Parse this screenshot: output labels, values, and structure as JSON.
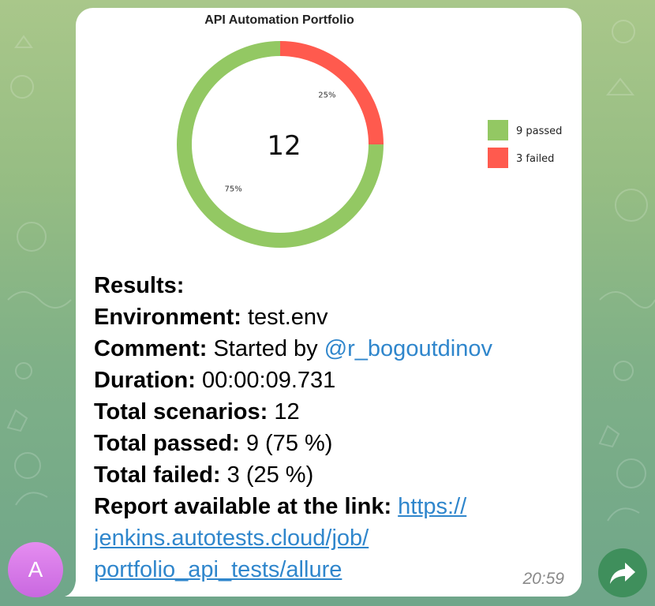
{
  "chart_data": {
    "type": "pie",
    "title": "API Automation Portfolio",
    "center_label": "12",
    "categories": [
      "passed",
      "failed"
    ],
    "values": [
      9,
      3
    ],
    "percent_labels": [
      "75%",
      "25%"
    ],
    "legend": [
      "9 passed",
      "3 failed"
    ],
    "legend_position": "right",
    "colors": [
      "#93c863",
      "#ff5a4e"
    ],
    "donut": true
  },
  "message": {
    "results_heading": "Results:",
    "environment_key": "Environment:",
    "environment_value": "test.env",
    "comment_key": "Comment:",
    "comment_value": "Started by",
    "comment_mention": "@r_bogoutdinov",
    "duration_key": "Duration:",
    "duration_value": "00:00:09.731",
    "scenarios_key": "Total scenarios:",
    "scenarios_value": "12",
    "passed_key": "Total passed:",
    "passed_value": "9 (75 %)",
    "failed_key": "Total failed:",
    "failed_value": "3 (25 %)",
    "report_key": "Report available at the link:",
    "report_link_part1": "https://",
    "report_link_part2": "jenkins.autotests.cloud/job/",
    "report_link_part3": "portfolio_api_tests/allure",
    "time": "20:59"
  },
  "avatar": {
    "letter": "A"
  },
  "icons": {
    "share": "share-arrow-icon"
  },
  "colors": {
    "link": "#2f86cc",
    "bubble": "#ffffff",
    "share_button": "#3f8f5c",
    "avatar": "#d57ae8"
  }
}
